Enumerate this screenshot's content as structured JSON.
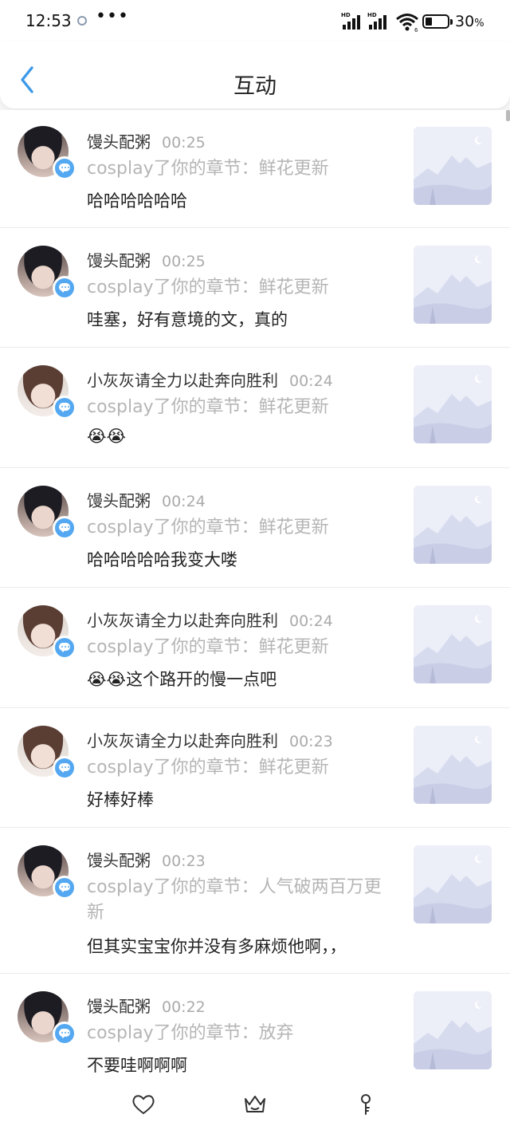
{
  "status_bar": {
    "time": "12:53",
    "dots": "•••",
    "signal_1_label": "HD",
    "signal_2_label": "HD",
    "wifi_sub": "6",
    "battery_level": 0.3,
    "battery_text": "30",
    "battery_unit": "%"
  },
  "header": {
    "title": "互动",
    "back_icon": "chevron-left-icon",
    "accent_color": "#3d9ae8"
  },
  "notifications": [
    {
      "user": "馒头配粥",
      "time": "00:25",
      "action": "cosplay了你的章节：鲜花更新",
      "comment": "哈哈哈哈哈哈",
      "avatar": "avatar-a"
    },
    {
      "user": "馒头配粥",
      "time": "00:25",
      "action": "cosplay了你的章节：鲜花更新",
      "comment": "哇塞，好有意境的文，真的",
      "avatar": "avatar-a"
    },
    {
      "user": "小灰灰请全力以赴奔向胜利",
      "time": "00:24",
      "action": "cosplay了你的章节：鲜花更新",
      "comment": "😭😭",
      "avatar": "avatar-b"
    },
    {
      "user": "馒头配粥",
      "time": "00:24",
      "action": "cosplay了你的章节：鲜花更新",
      "comment": "哈哈哈哈哈我变大喽",
      "avatar": "avatar-a"
    },
    {
      "user": "小灰灰请全力以赴奔向胜利",
      "time": "00:24",
      "action": "cosplay了你的章节：鲜花更新",
      "comment": "😭😭这个路开的慢一点吧",
      "avatar": "avatar-b"
    },
    {
      "user": "小灰灰请全力以赴奔向胜利",
      "time": "00:23",
      "action": "cosplay了你的章节：鲜花更新",
      "comment": "好棒好棒",
      "avatar": "avatar-b"
    },
    {
      "user": "馒头配粥",
      "time": "00:23",
      "action": "cosplay了你的章节：人气破两百万更新",
      "comment": "但其实宝宝你并没有多麻烦他啊，，",
      "avatar": "avatar-a"
    },
    {
      "user": "馒头配粥",
      "time": "00:22",
      "action": "cosplay了你的章节：放弃",
      "comment": "不要哇啊啊啊",
      "avatar": "avatar-a"
    }
  ],
  "tab_bar": {
    "tabs": [
      {
        "icon": "heart-icon"
      },
      {
        "icon": "crown-icon"
      },
      {
        "icon": "key-icon"
      }
    ]
  },
  "colors": {
    "badge": "#54a8f1",
    "meta_text": "#b5b5b5",
    "thumbnail_bg": "#eceef8"
  }
}
